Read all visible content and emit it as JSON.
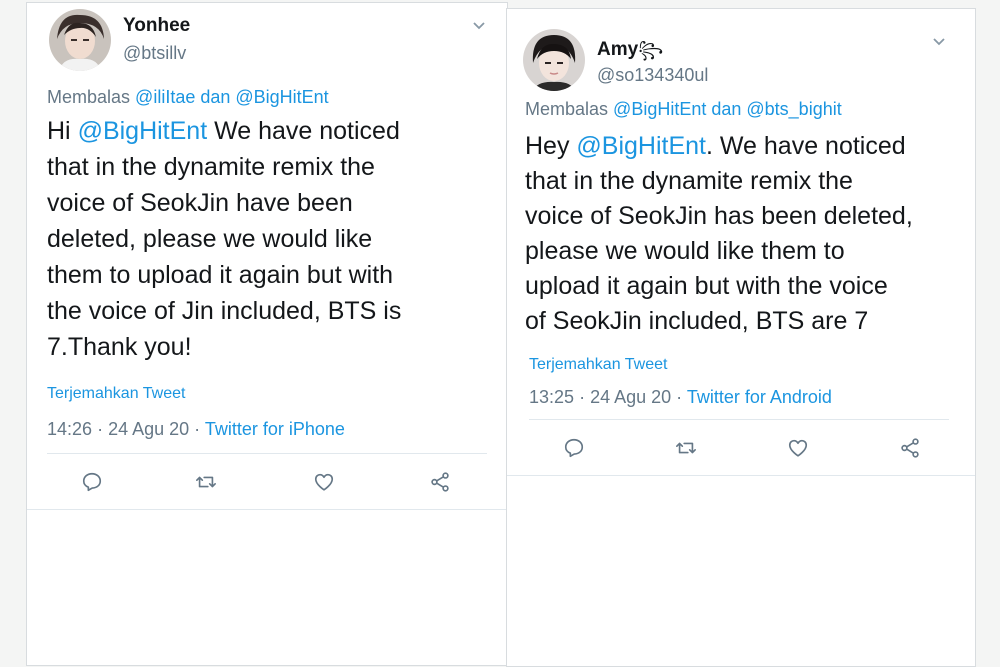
{
  "colors": {
    "link": "#1b95e0",
    "secondary_text": "#657786",
    "primary_text": "#14171a",
    "icon": "#657786"
  },
  "tweets": [
    {
      "name": "Yonhee",
      "handle": "@btsillv",
      "reply_prefix": "Membalas",
      "reply_mentions": "@iliItae dan @BigHitEnt",
      "body_lines": [
        {
          "pre": "Hi ",
          "mention": "@BigHitEnt",
          "post": " We have noticed"
        },
        {
          "pre": "that in the dynamite remix the"
        },
        {
          "pre": "voice of SeokJin  have been"
        },
        {
          "pre": "deleted, please we would like"
        },
        {
          "pre": "them to upload it again but with"
        },
        {
          "pre": "the voice of Jin included, BTS is"
        },
        {
          "pre": "7.Thank you!"
        }
      ],
      "translate": "Terjemahkan Tweet",
      "time": "14:26",
      "date": "24 Agu 20",
      "source": "Twitter for iPhone",
      "actions": [
        "reply-icon",
        "retweet-icon",
        "like-icon",
        "share-icon"
      ]
    },
    {
      "name": "Amy",
      "name_emoji": "꧂",
      "handle": "@so134340ul",
      "reply_prefix": "Membalas",
      "reply_mentions": "@BigHitEnt dan @bts_bighit",
      "body_lines": [
        {
          "pre": "Hey ",
          "mention": "@BigHitEnt",
          "post": ". We have noticed"
        },
        {
          "pre": "that in the dynamite remix the"
        },
        {
          "pre": "voice of SeokJin has been deleted,"
        },
        {
          "pre": "please we would like them to"
        },
        {
          "pre": "upload it again but with the voice"
        },
        {
          "pre": "of SeokJin included, BTS are 7"
        }
      ],
      "translate": "Terjemahkan Tweet",
      "time": "13:25",
      "date": "24 Agu 20",
      "source": "Twitter for Android",
      "actions": [
        "reply-icon",
        "retweet-icon",
        "like-icon",
        "share-icon"
      ]
    }
  ]
}
